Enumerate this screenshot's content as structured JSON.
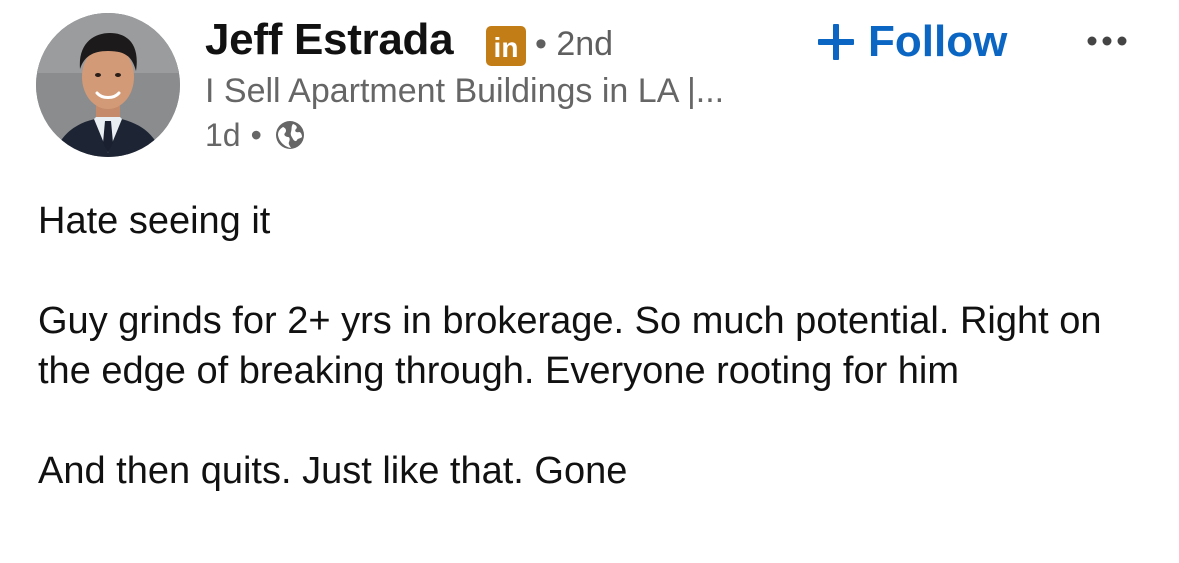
{
  "author": {
    "name": "Jeff Estrada",
    "badge_text": "in",
    "connection_dot": "•",
    "connection_degree": "2nd",
    "headline": "I Sell Apartment Buildings in LA |...",
    "avatar_icon": "person-avatar",
    "badge_icon": "linkedin-premium-icon"
  },
  "meta": {
    "time": "1d",
    "separator": "•",
    "visibility_icon": "globe-icon"
  },
  "actions": {
    "follow_label": "Follow",
    "follow_icon": "plus-icon",
    "more_icon": "more-horizontal-icon"
  },
  "post": {
    "paragraphs": [
      "Hate seeing it",
      "Guy grinds for 2+ yrs in brokerage. So much potential. Right on the edge of breaking through. Everyone rooting for him",
      "And then quits. Just like that. Gone"
    ]
  },
  "colors": {
    "accent": "#0a66c2",
    "badge": "#c37d16",
    "text_primary": "#111111",
    "text_secondary": "#666666"
  }
}
